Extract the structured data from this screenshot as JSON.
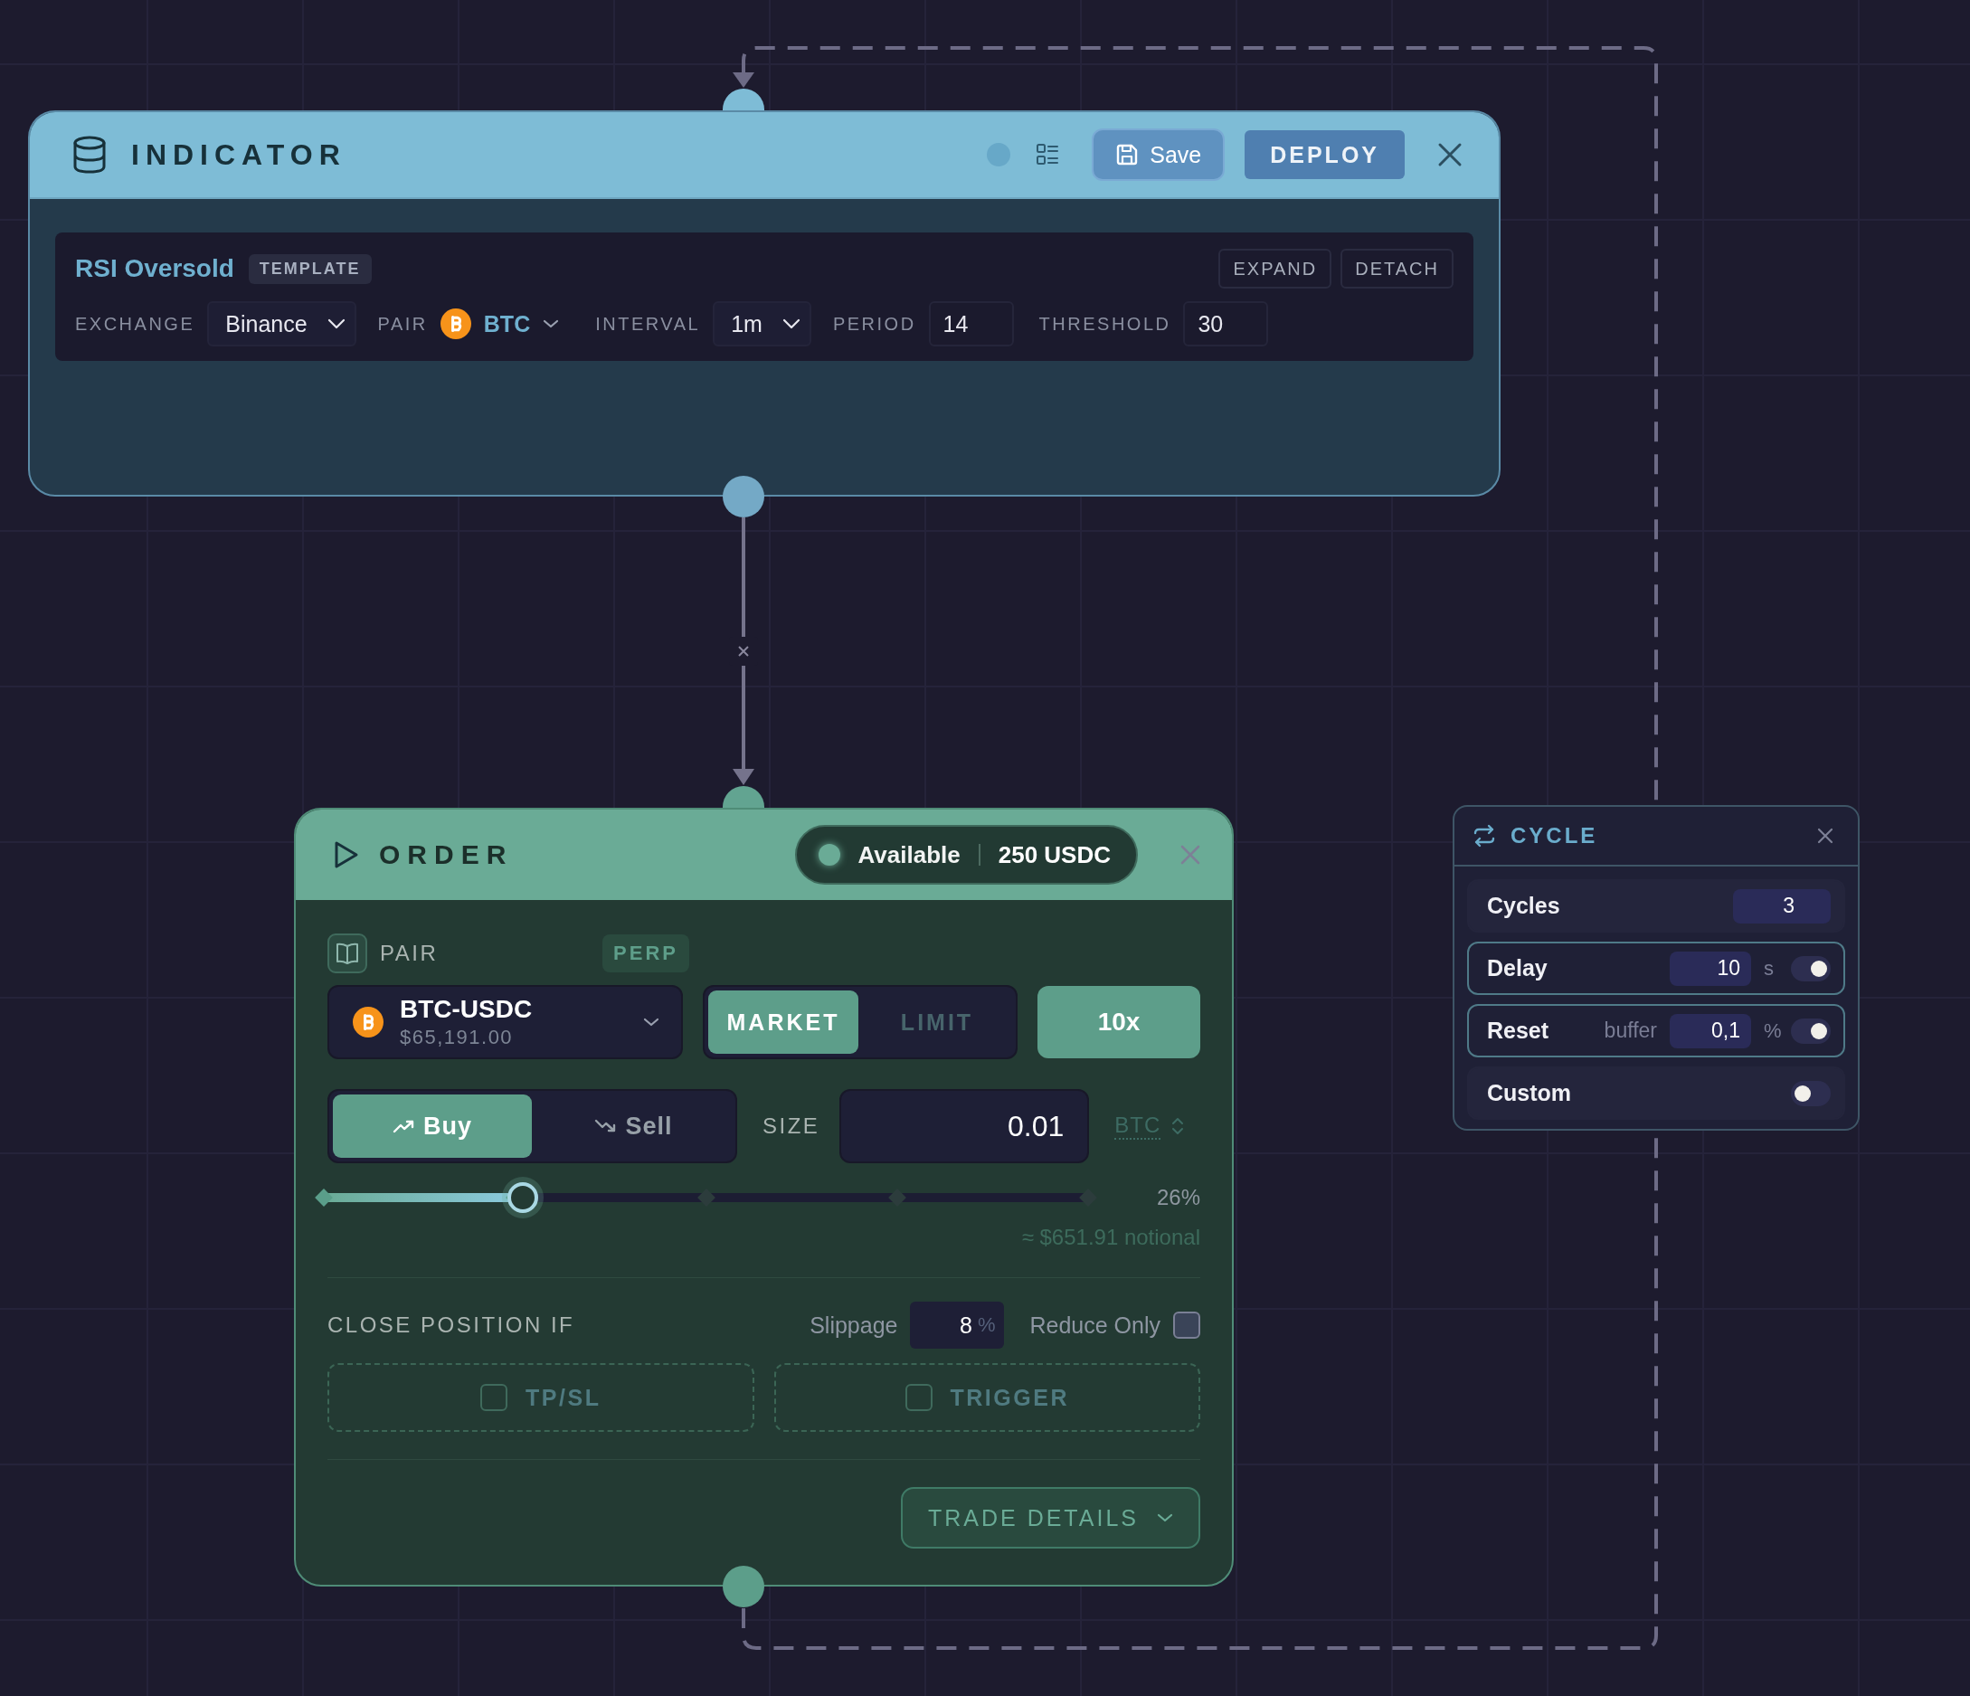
{
  "indicator": {
    "title": "INDICATOR",
    "save_button": "Save",
    "deploy_button": "DEPLOY",
    "card": {
      "name": "RSI Oversold",
      "badge": "TEMPLATE",
      "actions": [
        "EXPAND",
        "DETACH"
      ],
      "fields": [
        {
          "kind": "select",
          "label": "EXCHANGE",
          "value": "Binance"
        },
        {
          "kind": "coin-select",
          "label": "PAIR",
          "value": "BTC"
        },
        {
          "kind": "select",
          "label": "INTERVAL",
          "value": "1m"
        },
        {
          "kind": "input",
          "label": "PERIOD",
          "value": "14"
        },
        {
          "kind": "input",
          "label": "THRESHOLD",
          "value": "30"
        }
      ]
    }
  },
  "order": {
    "title": "ORDER",
    "available_label": "Available",
    "available_value": "250 USDC",
    "pair_label": "PAIR",
    "badge": "PERP",
    "pair": "BTC-USDC",
    "price": "$65,191.00",
    "order_types": [
      {
        "label": "MARKET",
        "selected": true
      },
      {
        "label": "LIMIT",
        "selected": false
      }
    ],
    "leverage": "10x",
    "sides": [
      {
        "kind": "buy",
        "label": "Buy",
        "selected": true
      },
      {
        "kind": "sell",
        "label": "Sell",
        "selected": false
      }
    ],
    "size_label": "SIZE",
    "size": "0.01",
    "size_unit": "BTC",
    "slider": {
      "level": 0.26,
      "reading": "26%"
    },
    "notional": "≈ $651.91 notional",
    "close_label": "CLOSE POSITION IF",
    "slippage_label": "Slippage",
    "slippage": "8",
    "slippage_unit": "%",
    "reduce_only": {
      "label": "Reduce Only",
      "checked": false
    },
    "conditions": [
      {
        "label": "TP/SL",
        "checked": false
      },
      {
        "label": "TRIGGER",
        "checked": false
      }
    ],
    "details_button": "TRADE DETAILS"
  },
  "cycle": {
    "title": "CYCLE",
    "rows": [
      {
        "kind": "number",
        "label": "Cycles",
        "value": "3"
      },
      {
        "kind": "toggle-input",
        "label": "Delay",
        "value": "10",
        "unit": "s",
        "on": true
      },
      {
        "kind": "toggle-input",
        "label": "Reset",
        "hint": "buffer",
        "value": "0,1",
        "unit": "%",
        "on": true
      },
      {
        "kind": "toggle",
        "label": "Custom",
        "on": false
      }
    ]
  }
}
